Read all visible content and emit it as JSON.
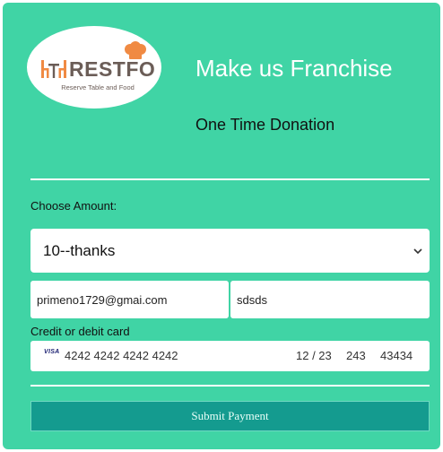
{
  "brand": {
    "name": "RESTFO",
    "tagline": "Reserve Table and Food"
  },
  "header": {
    "title": "Make us Franchise",
    "subtitle": "One Time Donation"
  },
  "form": {
    "amount_label": "Choose Amount:",
    "amount_selected": "10--thanks",
    "email_value": "primeno1729@gmai.com",
    "name_value": "sdsds",
    "card_label": "Credit or debit card",
    "card": {
      "brand": "VISA",
      "number": "4242 4242 4242 4242",
      "expiry": "12 / 23",
      "cvc": "243",
      "zip": "43434"
    },
    "submit_label": "Submit Payment"
  },
  "colors": {
    "panel_bg": "#40d4a5",
    "button_bg": "#149b8f",
    "logo_text": "#6b5d57",
    "hat": "#f08a43"
  },
  "icons": {
    "logo_mark": "table-chairs-icon",
    "logo_hat": "chef-hat-icon",
    "select_arrow": "chevron-down-icon",
    "card_brand": "visa-icon"
  }
}
